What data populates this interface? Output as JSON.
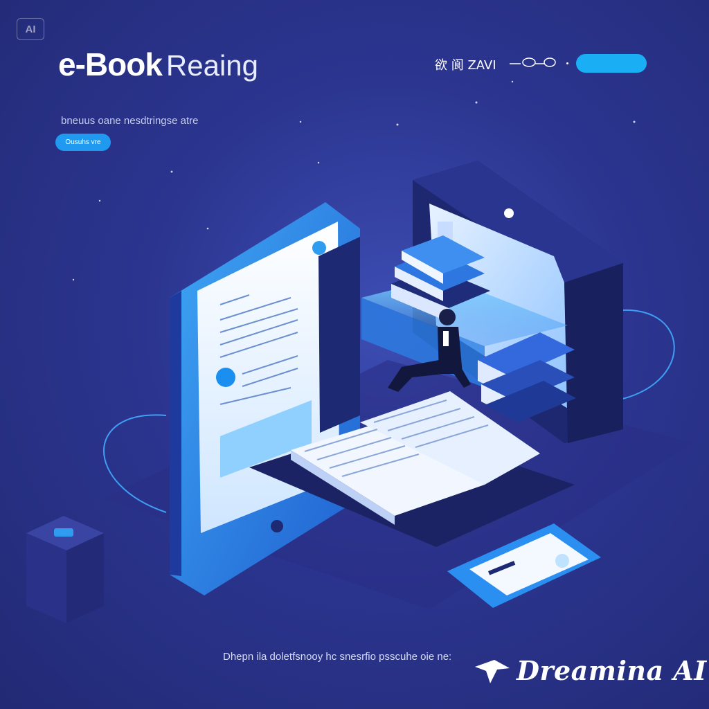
{
  "badge": {
    "label": "AI"
  },
  "header": {
    "title_strong": "e-Book",
    "title_light": "Reaing",
    "subtitle": "bneuus oane nesdtringse atre",
    "cta_label": "Ousuhs vre"
  },
  "nav": {
    "text": "欲 阆  ZAVI",
    "button_label": ""
  },
  "footer": {
    "caption": "Dhepn ila doletfsnooy hc snesrfio psscuhe oie ne:"
  },
  "watermark": {
    "text": "Dreamina AI"
  },
  "icons": {
    "badge": "ai-badge-icon",
    "watermark_logo": "dreamina-bird-logo-icon",
    "nav_glyph": "loop-glyph-icon"
  },
  "colors": {
    "background": "#2b358f",
    "accent": "#1aaef4",
    "tablet_frame": "#2f8ee6",
    "page_white": "#f1f6ff"
  }
}
